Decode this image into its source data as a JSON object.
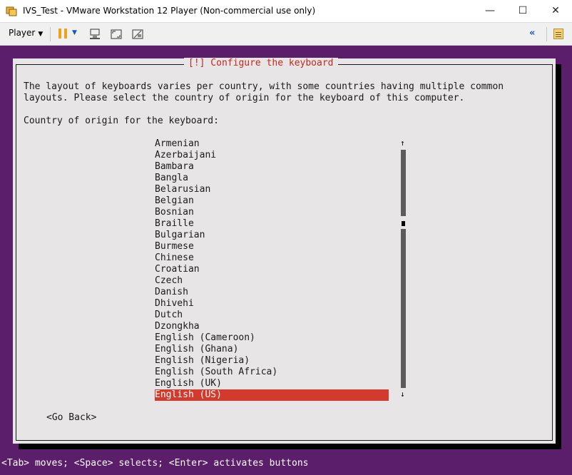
{
  "window": {
    "title": "IVS_Test - VMware Workstation 12 Player (Non-commercial use only)",
    "minimize": "—",
    "maximize": "☐",
    "close": "✕"
  },
  "toolbar": {
    "player_label": "Player",
    "player_caret": "▼",
    "pause_caret": "▼",
    "collapse_label": "«"
  },
  "installer": {
    "dialog_title": "[!] Configure the keyboard",
    "description_line1": "The layout of keyboards varies per country, with some countries having multiple common",
    "description_line2": "layouts. Please select the country of origin for the keyboard of this computer.",
    "prompt": "Country of origin for the keyboard:",
    "selected_index": 22,
    "countries": [
      {
        "label": "Armenian"
      },
      {
        "label": "Azerbaijani"
      },
      {
        "label": "Bambara"
      },
      {
        "label": "Bangla"
      },
      {
        "label": "Belarusian"
      },
      {
        "label": "Belgian"
      },
      {
        "label": "Bosnian"
      },
      {
        "label": "Braille"
      },
      {
        "label": "Bulgarian"
      },
      {
        "label": "Burmese"
      },
      {
        "label": "Chinese"
      },
      {
        "label": "Croatian"
      },
      {
        "label": "Czech"
      },
      {
        "label": "Danish"
      },
      {
        "label": "Dhivehi"
      },
      {
        "label": "Dutch"
      },
      {
        "label": "Dzongkha"
      },
      {
        "label": "English (Cameroon)"
      },
      {
        "label": "English (Ghana)"
      },
      {
        "label": "English (Nigeria)"
      },
      {
        "label": "English (South Africa)"
      },
      {
        "label": "English (UK)"
      },
      {
        "label": "English (US)"
      }
    ],
    "scroll_up": "↑",
    "scroll_down": "↓",
    "go_back": "<Go Back>",
    "status_bar": "<Tab> moves; <Space> selects; <Enter> activates buttons"
  },
  "colors": {
    "guest_background": "#5b1e6b",
    "dialog_background": "#e8e5e7",
    "title_red": "#c6281b",
    "selection_red": "#d13a2c"
  }
}
